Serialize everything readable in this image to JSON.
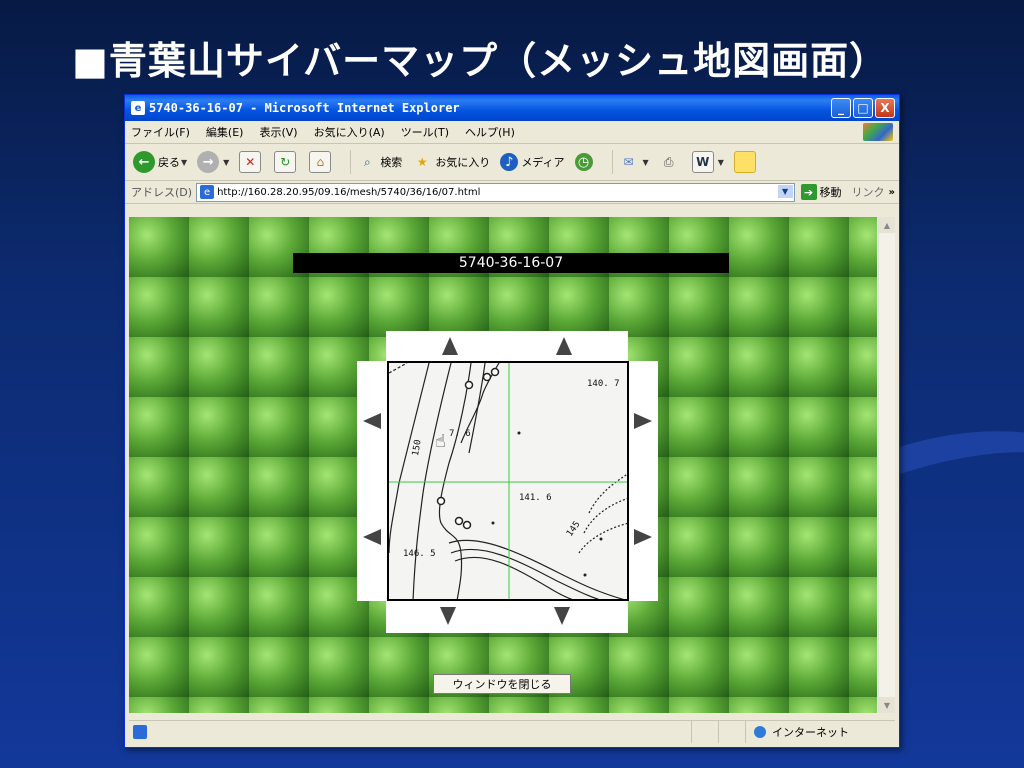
{
  "slide": {
    "title": "■青葉山サイバーマップ（メッシュ地図画面）"
  },
  "window": {
    "title": "5740-36-16-07 - Microsoft Internet Explorer",
    "buttons": {
      "minimize": "_",
      "maximize": "□",
      "close": "X"
    }
  },
  "menu": [
    "ファイル(F)",
    "編集(E)",
    "表示(V)",
    "お気に入り(A)",
    "ツール(T)",
    "ヘルプ(H)"
  ],
  "toolbar": {
    "back": "戻る",
    "search": "検索",
    "favorites": "お気に入り",
    "media": "メディア"
  },
  "address": {
    "label": "アドレス(D)",
    "url": "http://160.28.20.95/09.16/mesh/5740/36/16/07.html",
    "go": "移動",
    "links": "リンク"
  },
  "page": {
    "mesh_title": "5740-36-16-07",
    "map_labels": [
      "140. 7",
      "7. 6",
      "141. 6",
      "146. 5",
      "150",
      "145"
    ],
    "close_button": "ウィンドウを閉じる"
  },
  "status": {
    "zone": "インターネット"
  }
}
